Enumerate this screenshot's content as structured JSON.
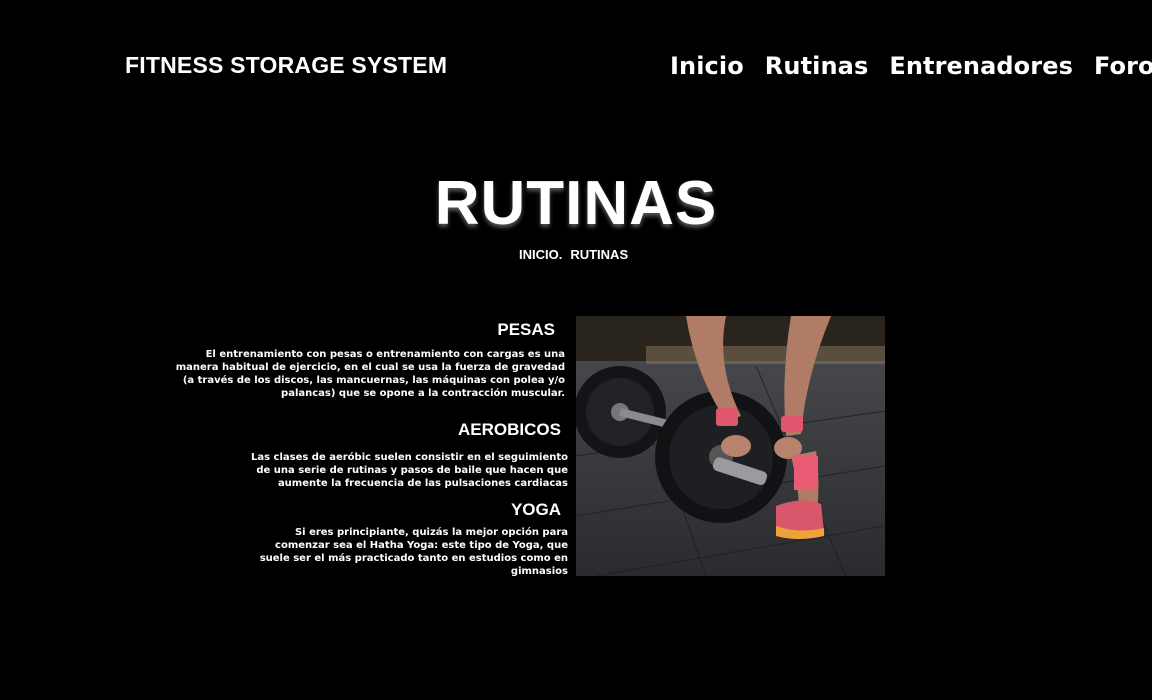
{
  "brand": "FITNESS STORAGE SYSTEM",
  "nav": [
    "Inicio",
    "Rutinas",
    "Entrenadores",
    "Foro"
  ],
  "hero": {
    "title": "RUTINAS",
    "breadcrumb_home": "INICIO.",
    "breadcrumb_current": "RUTINAS"
  },
  "sections": [
    {
      "title": "PESAS",
      "text": "El entrenamiento con pesas o entrenamiento con cargas es una manera habitual de ejercicio, en el cual se usa la fuerza de gravedad (a través de los discos, las mancuernas, las máquinas con polea y/o palancas) que se opone a la contracción muscular."
    },
    {
      "title": "AEROBICOS",
      "text": "Las clases de aeróbic suelen consistir en el seguimiento de una serie de rutinas y pasos de baile que hacen que aumente la frecuencia de las pulsaciones cardiacas"
    },
    {
      "title": "YOGA",
      "text": "Si eres principiante, quizás la mejor opción para comenzar sea el Hatha Yoga: este tipo de Yoga, que suele ser el más practicado tanto en estudios como en gimnasios"
    }
  ]
}
